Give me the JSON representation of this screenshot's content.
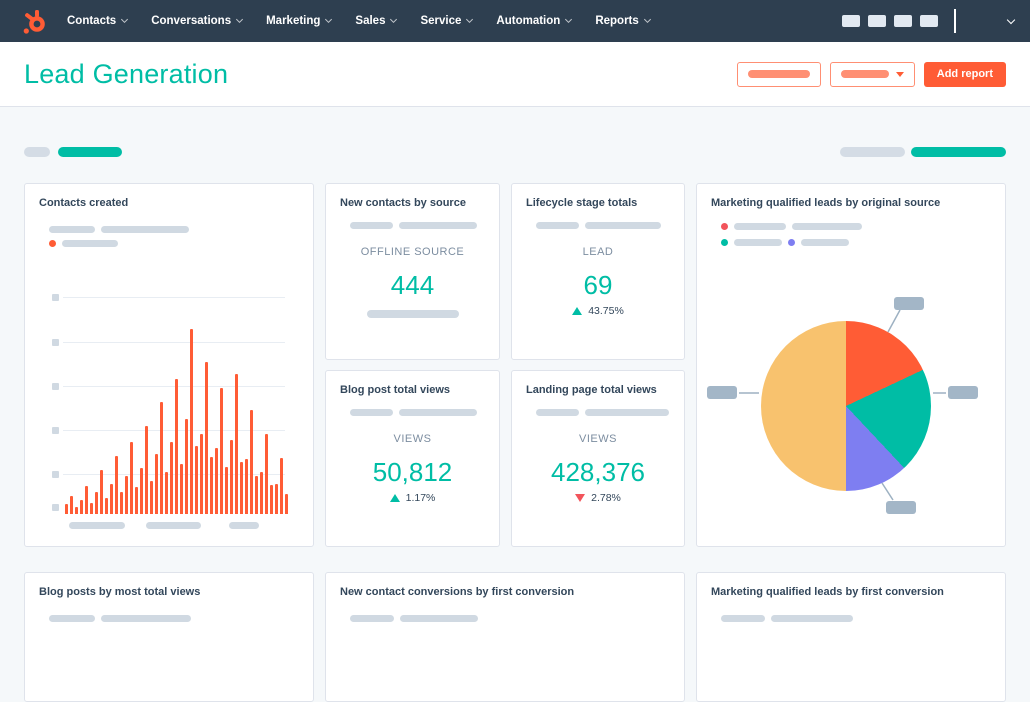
{
  "colors": {
    "brand_orange": "#ff5c35",
    "teal_accent": "#00bda5",
    "nav_background": "#2e3f50",
    "positive_delta": "#00bda5",
    "negative_delta": "#f2545b",
    "pie_orange": "#ff5c35",
    "pie_teal": "#00bda5",
    "pie_purple": "#7e7ef1",
    "pie_amber": "#f8c26e"
  },
  "nav": {
    "items": [
      "Contacts",
      "Conversations",
      "Marketing",
      "Sales",
      "Service",
      "Automation",
      "Reports"
    ]
  },
  "header": {
    "title": "Lead Generation",
    "add_report_label": "Add report"
  },
  "cards": {
    "contacts_created": {
      "title": "Contacts created",
      "chart_data": {
        "type": "bar",
        "bar_color": "#ff5c35",
        "values": [
          10,
          18,
          7,
          14,
          28,
          11,
          22,
          44,
          16,
          30,
          58,
          22,
          38,
          72,
          27,
          46,
          88,
          33,
          60,
          112,
          42,
          72,
          135,
          50,
          95,
          185,
          68,
          80,
          152,
          57,
          66,
          126,
          47,
          74,
          140,
          52,
          55,
          104,
          38,
          42,
          80,
          29,
          30,
          56,
          20
        ]
      }
    },
    "new_contacts_by_source": {
      "title": "New contacts by source",
      "metric_label": "OFFLINE SOURCE",
      "value": "444"
    },
    "lifecycle_stage_totals": {
      "title": "Lifecycle stage totals",
      "metric_label": "LEAD",
      "value": "69",
      "delta": "43.75%",
      "delta_direction": "up"
    },
    "blog_post_total_views": {
      "title": "Blog post total views",
      "metric_label": "VIEWS",
      "value": "50,812",
      "delta": "1.17%",
      "delta_direction": "up"
    },
    "landing_page_total_views": {
      "title": "Landing page total views",
      "metric_label": "VIEWS",
      "value": "428,376",
      "delta": "2.78%",
      "delta_direction": "down"
    },
    "mql_by_original_source": {
      "title": "Marketing qualified leads by original source",
      "chart_data": {
        "type": "pie",
        "slices": [
          {
            "value": 18,
            "color": "#ff5c35"
          },
          {
            "value": 20,
            "color": "#00bda5"
          },
          {
            "value": 12,
            "color": "#7e7ef1"
          },
          {
            "value": 50,
            "color": "#f8c26e"
          }
        ]
      }
    },
    "blog_posts_by_most_total_views": {
      "title": "Blog posts by most total views"
    },
    "new_contact_conversions_by_first_conversion": {
      "title": "New contact conversions by first conversion"
    },
    "mql_by_first_conversion": {
      "title": "Marketing qualified leads by first conversion"
    }
  }
}
